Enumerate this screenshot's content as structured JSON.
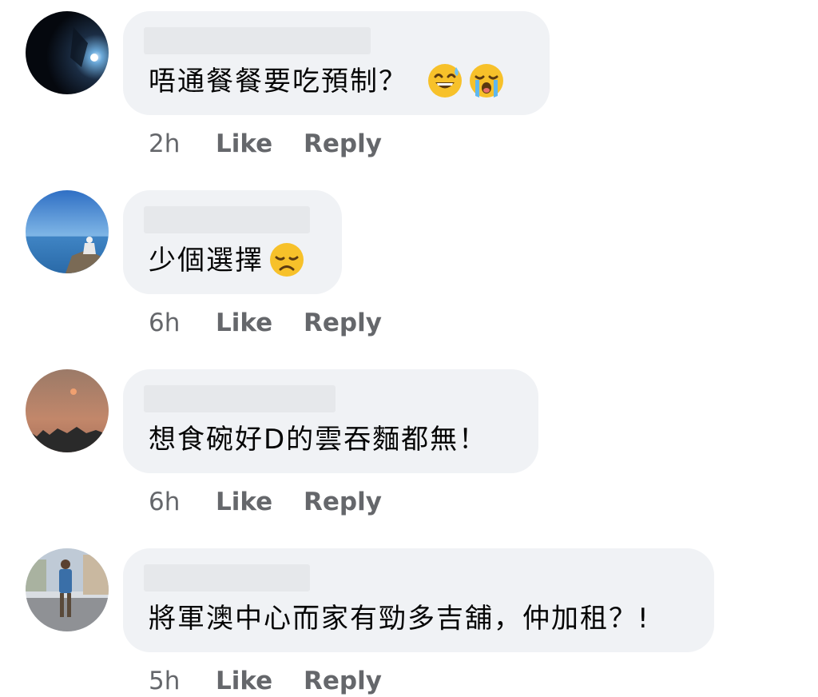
{
  "comments": [
    {
      "text": "唔通餐餐要吃預制？",
      "emojis": [
        "grinning-sweat-emoji",
        "loudly-crying-emoji"
      ],
      "time": "2h",
      "like_label": "Like",
      "reply_label": "Reply"
    },
    {
      "text": "少個選擇",
      "emojis": [
        "disappointed-emoji"
      ],
      "time": "6h",
      "like_label": "Like",
      "reply_label": "Reply"
    },
    {
      "text": "想食碗好D的雲吞麵都無！",
      "emojis": [],
      "time": "6h",
      "like_label": "Like",
      "reply_label": "Reply"
    },
    {
      "text": "將軍澳中心而家有勁多吉舖，仲加租？!",
      "emojis": [],
      "time": "5h",
      "like_label": "Like",
      "reply_label": "Reply"
    }
  ],
  "colors": {
    "bubble": "#f0f2f5",
    "text": "#050505",
    "meta": "#65676b"
  }
}
